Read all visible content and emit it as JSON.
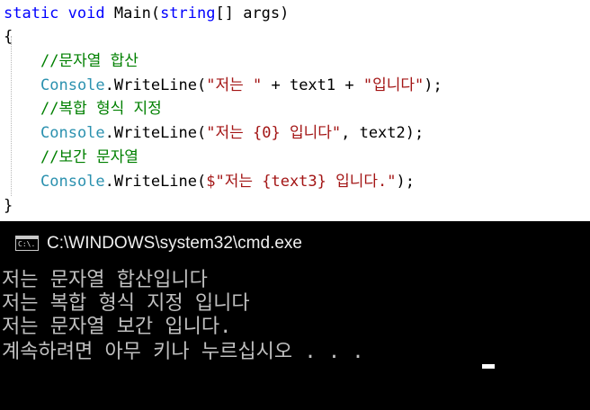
{
  "editor": {
    "signature": {
      "kw1": "static",
      "kw2": "void",
      "name": "Main(",
      "type": "string",
      "rest": "[] args)"
    },
    "open_brace": "{",
    "close_brace": "}",
    "lines": [
      {
        "kind": "comment",
        "text": "//문자열 합산"
      },
      {
        "kind": "call",
        "cls": "Console",
        "method": ".WriteLine(",
        "str": "\"저는 \"",
        "rest": " + text1 + ",
        "str2": "\"입니다\"",
        "end": ");"
      },
      {
        "kind": "comment",
        "text": "//복합 형식 지정"
      },
      {
        "kind": "call",
        "cls": "Console",
        "method": ".WriteLine(",
        "str": "\"저는 {0} 입니다\"",
        "rest": ", text2",
        "str2": "",
        "end": ");"
      },
      {
        "kind": "comment",
        "text": "//보간 문자열"
      },
      {
        "kind": "call",
        "cls": "Console",
        "method": ".WriteLine(",
        "str": "$\"저는 {text3} 입니다.\"",
        "rest": "",
        "str2": "",
        "end": ");"
      }
    ]
  },
  "console": {
    "title": "C:\\WINDOWS\\system32\\cmd.exe",
    "icon": "cmd-window-icon",
    "icon_text": "C:\\.",
    "output": [
      "저는 문자열 합산입니다",
      "저는 복합 형식 지정 입니다",
      "저는 문자열 보간 입니다.",
      "계속하려면 아무 키나 누르십시오 . . ."
    ]
  },
  "colors": {
    "keyword": "#0000ff",
    "type": "#2b91af",
    "string": "#a31515",
    "comment": "#008000"
  }
}
